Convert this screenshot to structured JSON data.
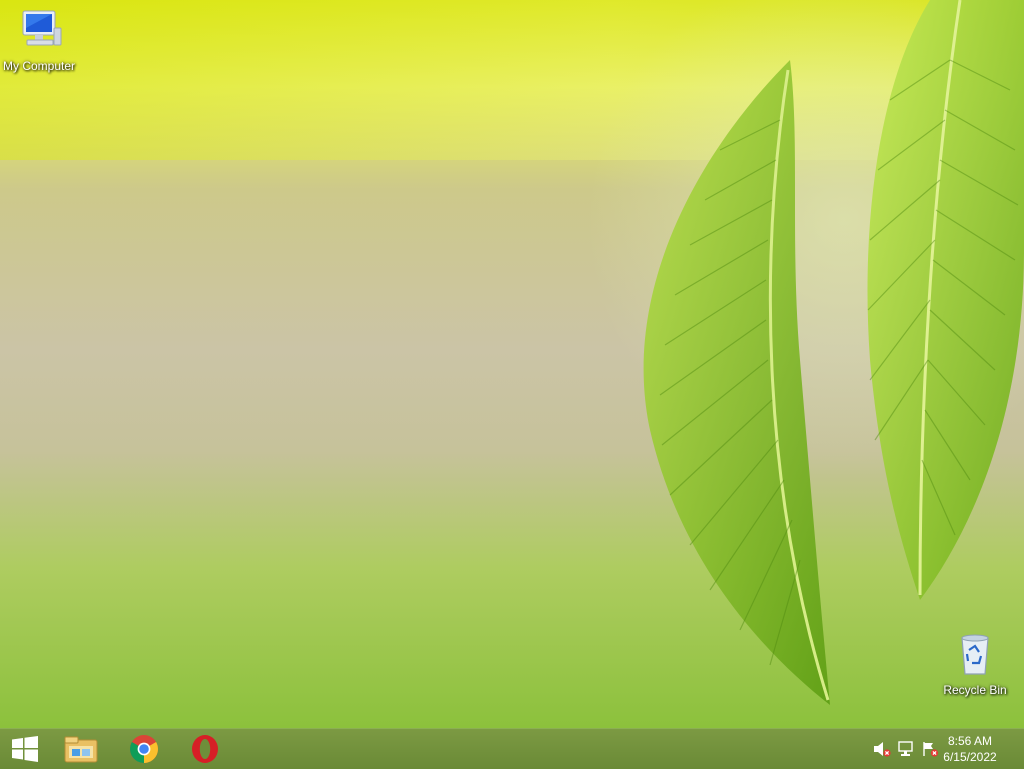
{
  "desktop": {
    "icons": [
      {
        "label": "My Computer",
        "icon": "computer-icon"
      },
      {
        "label": "Recycle Bin",
        "icon": "recycle-bin-icon"
      }
    ]
  },
  "taskbar": {
    "start": {
      "icon": "windows-logo-icon"
    },
    "pinned": [
      {
        "icon": "file-explorer-icon"
      },
      {
        "icon": "chrome-icon"
      },
      {
        "icon": "opera-icon"
      }
    ],
    "tray": [
      {
        "icon": "volume-muted-icon"
      },
      {
        "icon": "network-icon"
      },
      {
        "icon": "action-center-flag-icon"
      }
    ],
    "clock": {
      "time": "8:56 AM",
      "date": "6/15/2022"
    }
  },
  "colors": {
    "taskbar": "#6f8e3a",
    "label_text": "#ffffff",
    "accent_green": "#7cb82f"
  }
}
